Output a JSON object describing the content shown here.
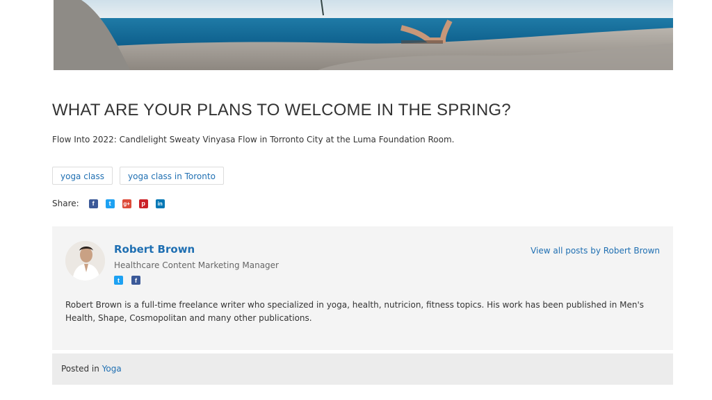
{
  "post": {
    "title": "WHAT ARE YOUR PLANS TO WELCOME IN THE SPRING?",
    "subtitle": "Flow Into 2022: Candlelight Sweaty Vinyasa Flow in Torronto City at the Luma Foundation Room."
  },
  "tags": [
    {
      "label": "yoga class"
    },
    {
      "label": "yoga class in Toronto"
    }
  ],
  "share": {
    "label": "Share:",
    "icons": [
      {
        "name": "facebook-icon",
        "glyph": "f",
        "color": "#3b5998"
      },
      {
        "name": "twitter-icon",
        "glyph": "t",
        "color": "#1da1f2"
      },
      {
        "name": "google-plus-icon",
        "glyph": "g+",
        "color": "#dd4b39"
      },
      {
        "name": "pinterest-icon",
        "glyph": "p",
        "color": "#cb2027"
      },
      {
        "name": "linkedin-icon",
        "glyph": "in",
        "color": "#0077b5"
      }
    ]
  },
  "author": {
    "name": "Robert Brown",
    "role": "Healthcare Content Marketing Manager",
    "view_all": "View all posts by Robert Brown",
    "bio": "Robert Brown is a full-time freelance writer who specialized in yoga, health, nutricion, fitness topics. His work has been published in Men's Health, Shape, Cosmopolitan and many other publications.",
    "social": [
      {
        "name": "twitter-icon",
        "glyph": "t",
        "color": "#1da1f2"
      },
      {
        "name": "facebook-icon",
        "glyph": "f",
        "color": "#3b5998"
      }
    ]
  },
  "footer": {
    "posted_in": "Posted in",
    "category": "Yoga"
  },
  "colors": {
    "link": "#1f6fb2",
    "box_bg": "#f4f4f4",
    "footer_bg": "#ececec"
  }
}
